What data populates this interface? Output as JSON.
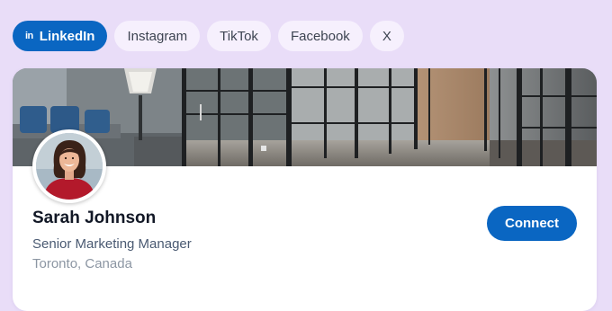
{
  "tabs": [
    {
      "label": "LinkedIn",
      "icon": "linkedin-icon",
      "icon_glyph": "in",
      "active": true
    },
    {
      "label": "Instagram",
      "active": false
    },
    {
      "label": "TikTok",
      "active": false
    },
    {
      "label": "Facebook",
      "active": false
    },
    {
      "label": "X",
      "active": false
    }
  ],
  "profile": {
    "name": "Sarah Johnson",
    "title": "Senior Marketing Manager",
    "location": "Toronto, Canada",
    "connect_label": "Connect"
  },
  "colors": {
    "accent": "#0a66c2",
    "background": "#e9ddf8",
    "tab_bg": "#f6f0fd"
  }
}
